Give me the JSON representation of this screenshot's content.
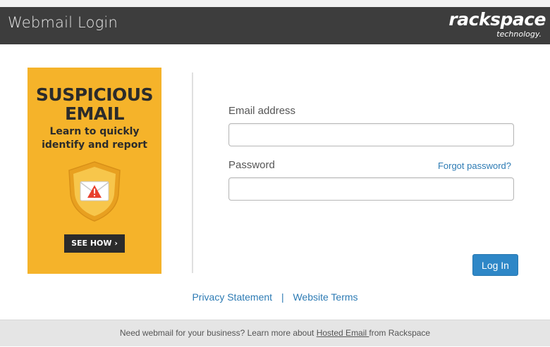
{
  "header": {
    "title": "Webmail Login",
    "logo_main": "rackspace",
    "logo_sub": "technology."
  },
  "ad": {
    "headline_line1": "SUSPICIOUS",
    "headline_line2": "EMAIL",
    "subtext_line1": "Learn to quickly",
    "subtext_line2": "identify and report",
    "cta_label": "SEE HOW",
    "icon": "shield-email-warning-icon",
    "background_color": "#f5b32a"
  },
  "form": {
    "email_label": "Email address",
    "email_value": "",
    "password_label": "Password",
    "password_value": "",
    "forgot_label": "Forgot password?",
    "login_label": "Log In"
  },
  "links": {
    "privacy": "Privacy Statement",
    "separator": "|",
    "terms": "Website Terms"
  },
  "footer": {
    "text_before": "Need webmail for your business? Learn more about ",
    "link": "Hosted Email ",
    "text_after": "from Rackspace"
  },
  "colors": {
    "header_bg": "#3d3d3d",
    "link": "#2d7bb4",
    "button": "#2e87c7"
  }
}
